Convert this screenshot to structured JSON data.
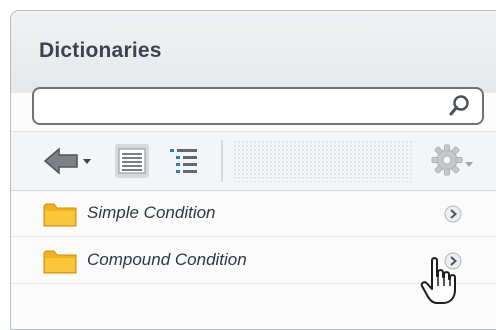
{
  "panel": {
    "title": "Dictionaries"
  },
  "search": {
    "value": "",
    "placeholder": "",
    "icon": "search-icon"
  },
  "toolbar": {
    "back_icon": "back-arrow-dropdown-icon",
    "details_view_icon": "details-view-icon",
    "list_view_icon": "list-view-icon",
    "settings_icon": "gear-dropdown-icon"
  },
  "items": [
    {
      "label": "Simple Condition",
      "icon": "folder-icon",
      "action_icon": "chevron-right-icon"
    },
    {
      "label": "Compound Condition",
      "icon": "folder-icon",
      "action_icon": "chevron-right-icon"
    }
  ],
  "colors": {
    "title": "#3c4350",
    "folder": "#f2b21f",
    "panel_border": "#b9bec4"
  }
}
